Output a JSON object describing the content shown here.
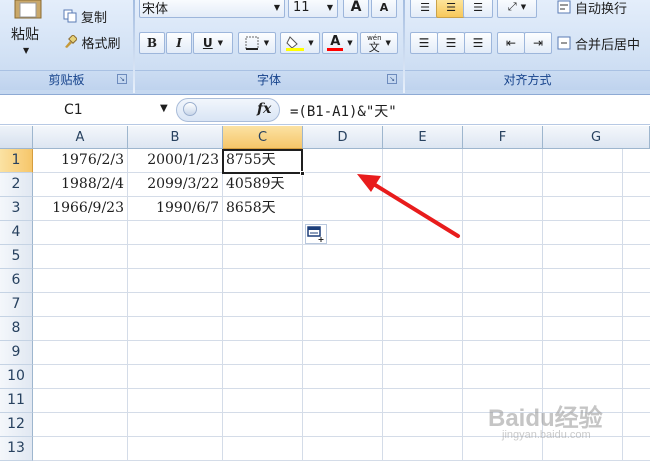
{
  "ribbon": {
    "clipboard": {
      "paste_label": "粘贴",
      "copy_label": "复制",
      "format_painter_label": "格式刷",
      "caption": "剪贴板"
    },
    "font": {
      "font_name": "宋体",
      "font_size": "11",
      "caption": "字体",
      "bold": "B",
      "italic": "I",
      "underline": "U",
      "font_color_letter": "A",
      "grow_font": "A",
      "shrink_font": "A",
      "phonetic": "wén",
      "phonetic_char": "文",
      "accent_color": "#ff0000",
      "highlight_color": "#ffff00"
    },
    "alignment": {
      "wrap_text_label": "自动换行",
      "merge_center_label": "合并后居中",
      "caption": "对齐方式"
    }
  },
  "formula_bar": {
    "name_box": "C1",
    "fx_label": "fx",
    "formula": "=(B1-A1)&\"天\""
  },
  "sheet": {
    "columns": [
      "A",
      "B",
      "C",
      "D",
      "E",
      "F",
      "G"
    ],
    "rows": [
      "1",
      "2",
      "3",
      "4",
      "5",
      "6",
      "7",
      "8",
      "9",
      "10",
      "11",
      "12",
      "13"
    ],
    "selected_column": "C",
    "selected_row": "1",
    "active_cell": "C1",
    "data": [
      {
        "a": "1976/2/3",
        "b": "2000/1/23",
        "c": "8755天"
      },
      {
        "a": "1988/2/4",
        "b": "2099/3/22",
        "c": "40589天"
      },
      {
        "a": "1966/9/23",
        "b": "1990/6/7",
        "c": "8658天"
      }
    ]
  },
  "annotation": {
    "arrow_color": "#e81c1c"
  },
  "watermark": {
    "text": "Baidu经验",
    "sub": "jingyan.baidu.com"
  }
}
